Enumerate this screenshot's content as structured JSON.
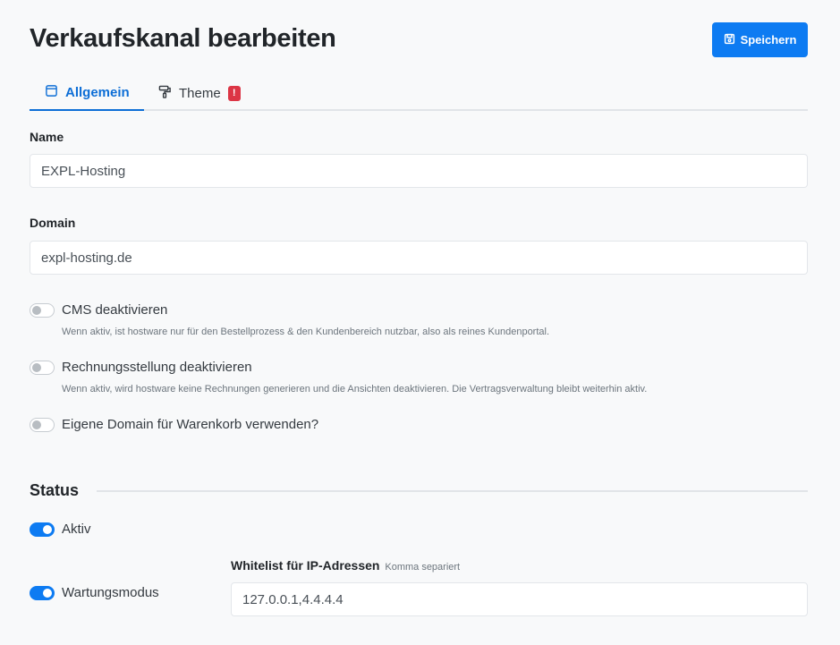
{
  "header": {
    "title": "Verkaufskanal bearbeiten",
    "save_label": "Speichern"
  },
  "tabs": [
    {
      "label": "Allgemein",
      "icon": "window-icon",
      "active": true
    },
    {
      "label": "Theme",
      "icon": "paint-roller-icon",
      "badge": "!"
    }
  ],
  "form": {
    "name_label": "Name",
    "name_value": "EXPL-Hosting",
    "domain_label": "Domain",
    "domain_value": "expl-hosting.de",
    "toggles": [
      {
        "label": "CMS deaktivieren",
        "help": "Wenn aktiv, ist hostware nur für den Bestellprozess & den Kundenbereich nutzbar, also als reines Kundenportal.",
        "checked": false
      },
      {
        "label": "Rechnungsstellung deaktivieren",
        "help": "Wenn aktiv, wird hostware keine Rechnungen generieren und die Ansichten deaktivieren. Die Vertragsverwaltung bleibt weiterhin aktiv.",
        "checked": false
      },
      {
        "label": "Eigene Domain für Warenkorb verwenden?",
        "checked": false
      }
    ]
  },
  "status": {
    "title": "Status",
    "aktiv_label": "Aktiv",
    "aktiv_checked": true,
    "wartung_label": "Wartungsmodus",
    "wartung_checked": true,
    "whitelist_label": "Whitelist für IP-Adressen",
    "whitelist_hint": "Komma separiert",
    "whitelist_value": "127.0.0.1,4.4.4.4"
  },
  "colors": {
    "primary": "#0d7bf2",
    "danger": "#dc3545",
    "background": "#f8f9fa"
  }
}
